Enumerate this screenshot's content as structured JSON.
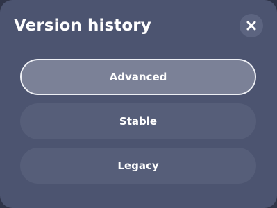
{
  "dialog": {
    "title": "Version history",
    "close_icon": "close-icon"
  },
  "options": [
    {
      "label": "Advanced",
      "selected": true
    },
    {
      "label": "Stable",
      "selected": false
    },
    {
      "label": "Legacy",
      "selected": false
    }
  ],
  "colors": {
    "panel_background": "#4c5470",
    "option_background": "#565e79",
    "selected_background": "#7b8197",
    "selected_border": "#eef0f5",
    "text": "#ffffff"
  }
}
